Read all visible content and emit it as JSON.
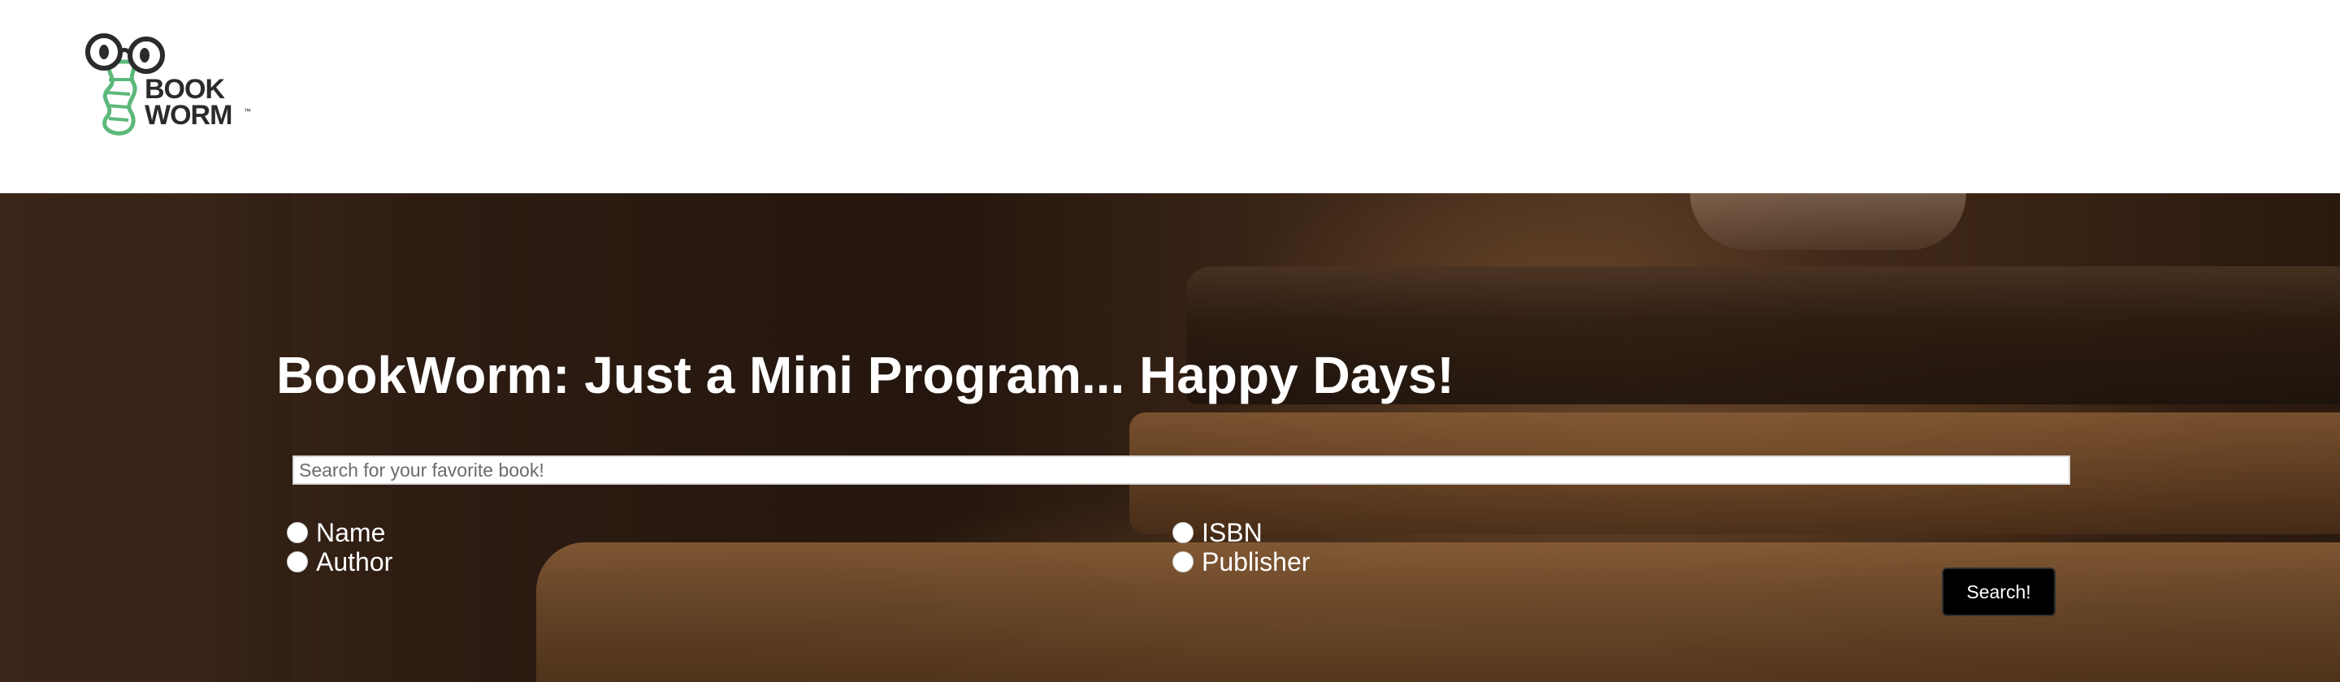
{
  "brand": {
    "logo_line1": "BOOK",
    "logo_line2": "WORM",
    "trademark": "™",
    "colors": {
      "worm": "#5cb87a",
      "text": "#2b2b2b"
    }
  },
  "hero": {
    "title": "BookWorm: Just a Mini Program... Happy Days!",
    "background_description_icon": "books-photo-background"
  },
  "search": {
    "value": "",
    "placeholder": "Search for your favorite book!",
    "button_label": "Search!"
  },
  "filters": {
    "options": [
      {
        "label": "Name",
        "selected": false
      },
      {
        "label": "Author",
        "selected": false
      },
      {
        "label": "ISBN",
        "selected": false
      },
      {
        "label": "Publisher",
        "selected": false
      }
    ]
  }
}
